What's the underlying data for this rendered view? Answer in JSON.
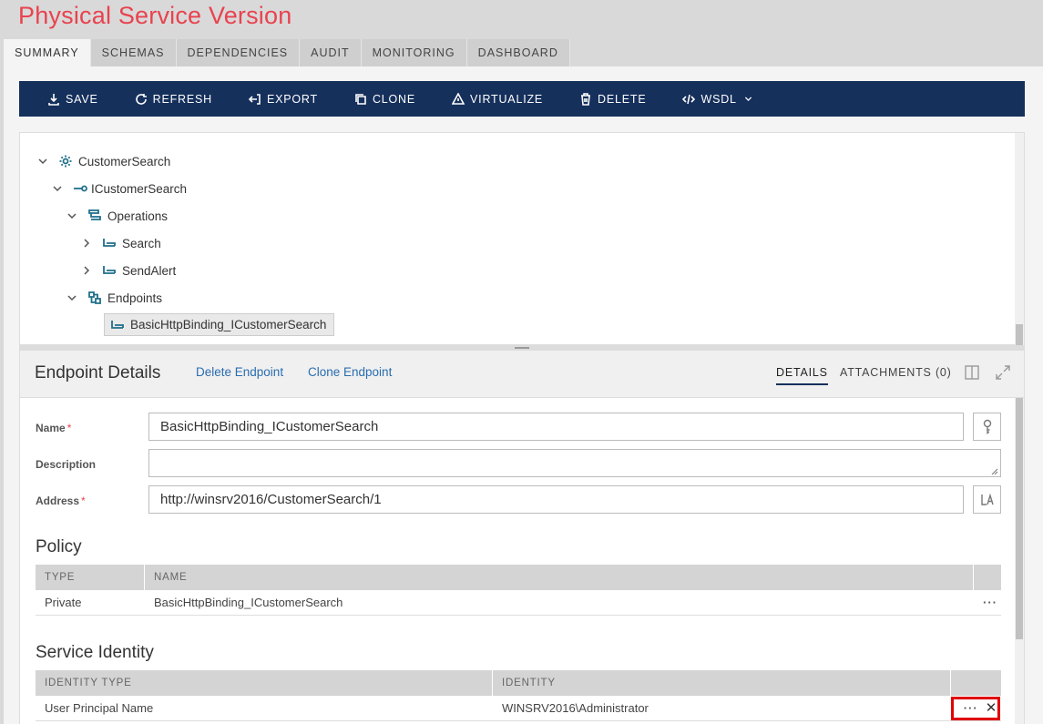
{
  "page": {
    "title": "Physical Service Version"
  },
  "tabs": [
    "SUMMARY",
    "SCHEMAS",
    "DEPENDENCIES",
    "AUDIT",
    "MONITORING",
    "DASHBOARD"
  ],
  "toolbar": {
    "save": "SAVE",
    "refresh": "REFRESH",
    "export": "EXPORT",
    "clone": "CLONE",
    "virtualize": "VIRTUALIZE",
    "delete": "DELETE",
    "wsdl": "WSDL"
  },
  "tree": {
    "service": "CustomerSearch",
    "contract": "ICustomerSearch",
    "operations": "Operations",
    "op1": "Search",
    "op2": "SendAlert",
    "endpoints": "Endpoints",
    "endpoint1": "BasicHttpBinding_ICustomerSearch"
  },
  "details": {
    "title": "Endpoint Details",
    "delete_link": "Delete Endpoint",
    "clone_link": "Clone Endpoint",
    "tab_details": "DETAILS",
    "tab_attachments": "ATTACHMENTS (0)"
  },
  "form": {
    "name_label": "Name",
    "name_value": "BasicHttpBinding_ICustomerSearch",
    "description_label": "Description",
    "description_value": "",
    "address_label": "Address",
    "address_value": "http://winsrv2016/CustomerSearch/1",
    "required_mark": "*"
  },
  "policy": {
    "title": "Policy",
    "columns": [
      "TYPE",
      "NAME"
    ],
    "rows": [
      {
        "type": "Private",
        "name": "BasicHttpBinding_ICustomerSearch"
      }
    ],
    "more": "···"
  },
  "identity": {
    "title": "Service Identity",
    "columns": [
      "IDENTITY TYPE",
      "IDENTITY"
    ],
    "rows": [
      {
        "type": "User Principal Name",
        "identity": "WINSRV2016\\Administrator"
      }
    ],
    "more": "···",
    "remove": "✕"
  },
  "colors": {
    "title_red": "#e8434f",
    "toolbar_navy": "#16305c",
    "link_blue": "#2a6db0",
    "tree_icon_teal": "#1f6f8a",
    "highlight_red": "#e00000"
  }
}
